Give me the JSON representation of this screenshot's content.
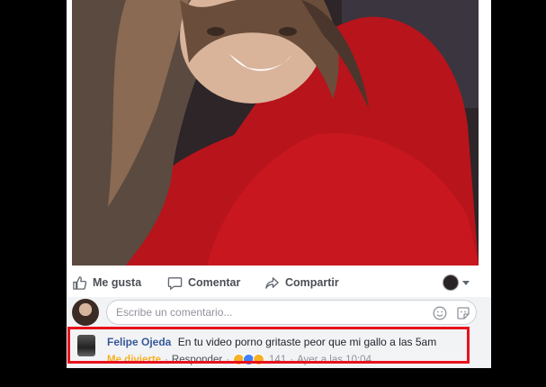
{
  "post": {
    "actions": {
      "like": "Me gusta",
      "comment": "Comentar",
      "share": "Compartir"
    }
  },
  "composer": {
    "placeholder": "Escribe un comentario..."
  },
  "comment": {
    "author": "Felipe Ojeda",
    "text": "En tu video porno gritaste peor que mi gallo a las 5am",
    "reaction_label": "Me divierte",
    "reply": "Responder",
    "reaction_count": "141",
    "timestamp": "Ayer a las 10:04"
  },
  "colors": {
    "link_blue": "#365899",
    "highlight_red": "#e8121c",
    "haha_yellow": "#f7b125"
  }
}
